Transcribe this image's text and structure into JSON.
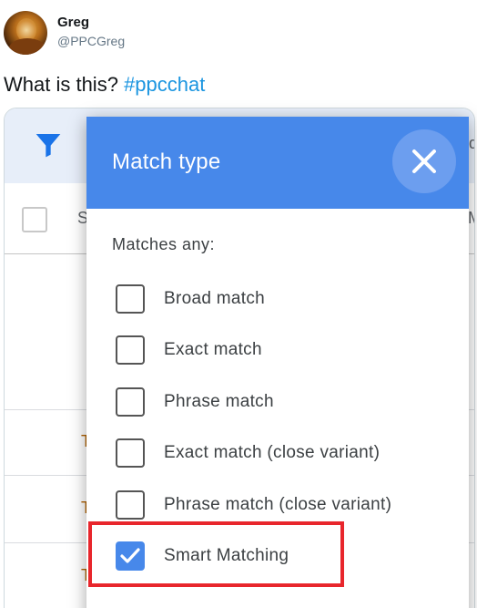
{
  "tweet": {
    "author_name": "Greg",
    "author_handle": "@PPCGreg",
    "text": "What is this?",
    "hashtag": "#ppcchat"
  },
  "screenshot": {
    "toolbar": {
      "icon": "filter-icon",
      "fragment_right": "d"
    },
    "table_header": {
      "fragment_left": "S",
      "fragment_right": "M"
    },
    "row_fragments": [
      "T",
      "T",
      "T"
    ],
    "dialog": {
      "title": "Match type",
      "close_icon": "close-icon",
      "matches_label": "Matches any:",
      "options": [
        {
          "label": "Broad match",
          "checked": false
        },
        {
          "label": "Exact match",
          "checked": false
        },
        {
          "label": "Phrase match",
          "checked": false
        },
        {
          "label": "Exact match (close variant)",
          "checked": false
        },
        {
          "label": "Phrase match (close variant)",
          "checked": false
        },
        {
          "label": "Smart Matching",
          "checked": true
        }
      ]
    }
  },
  "colors": {
    "dialog_header": "#4788ea",
    "hashtag": "#1b95e0",
    "highlight": "#e8262c"
  }
}
